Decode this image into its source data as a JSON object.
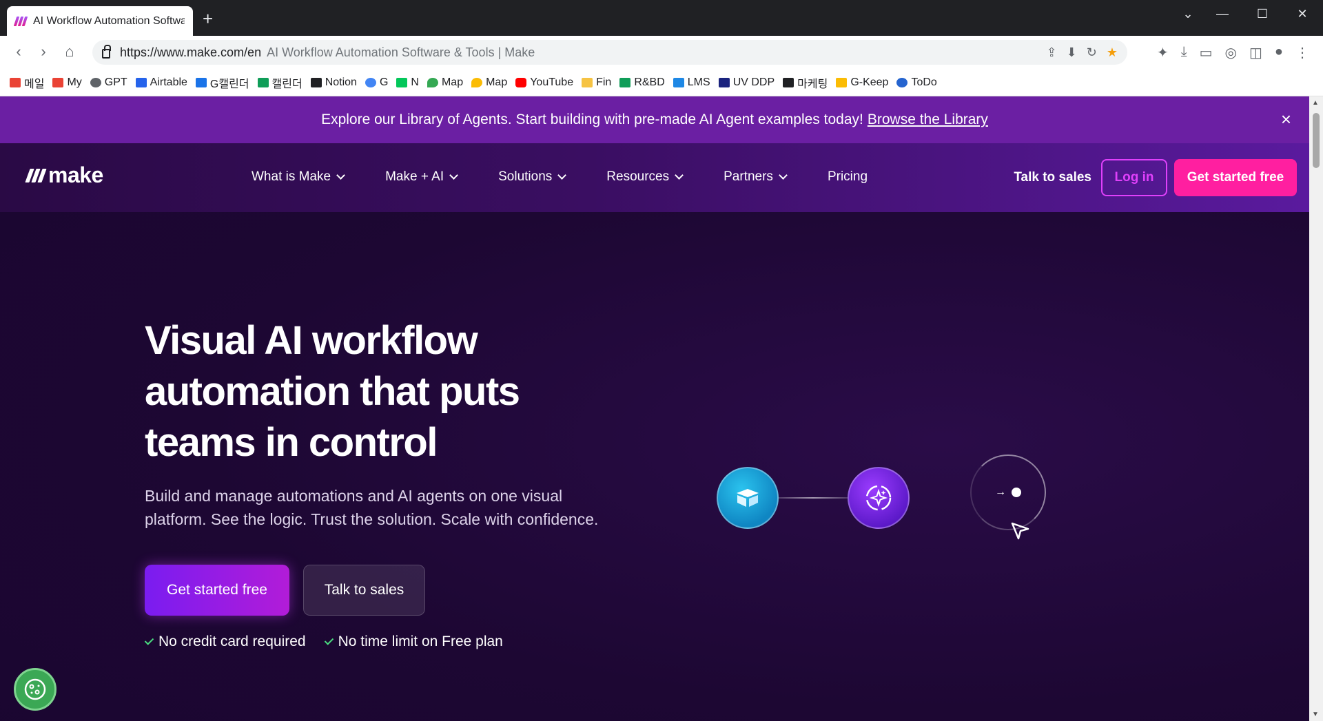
{
  "browser": {
    "tab_title": "AI Workflow Automation Softwa",
    "new_tab_symbol": "+",
    "url": "https://www.make.com/en",
    "omnibox_page_title": "AI Workflow Automation Software & Tools | Make",
    "bookmarks": [
      {
        "label": "메일",
        "color": "#ea4335"
      },
      {
        "label": "My",
        "color": "#ea4335"
      },
      {
        "label": "GPT",
        "color": "#5f6368"
      },
      {
        "label": "Airtable",
        "color": "#2563eb"
      },
      {
        "label": "G캘린더",
        "color": "#1a73e8"
      },
      {
        "label": "캘린더",
        "color": "#0f9d58"
      },
      {
        "label": "Notion",
        "color": "#202124"
      },
      {
        "label": "G",
        "color": "#4285f4"
      },
      {
        "label": "N",
        "color": "#03c75a"
      },
      {
        "label": "Map",
        "color": "#34a853"
      },
      {
        "label": "Map",
        "color": "#fbbc04"
      },
      {
        "label": "YouTube",
        "color": "#ff0000"
      },
      {
        "label": "Fin",
        "color": "#f6c343"
      },
      {
        "label": "R&BD",
        "color": "#0f9d58"
      },
      {
        "label": "LMS",
        "color": "#1e88e5"
      },
      {
        "label": "UV DDP",
        "color": "#1a237e"
      },
      {
        "label": "마케팅",
        "color": "#202124"
      },
      {
        "label": "G-Keep",
        "color": "#fbbc04"
      },
      {
        "label": "ToDo",
        "color": "#2564cf"
      }
    ]
  },
  "banner": {
    "text": "Explore our Library of Agents. Start building with pre-made AI Agent examples today!",
    "link": "Browse the Library",
    "close_symbol": "×"
  },
  "nav": {
    "logo_text": "make",
    "items": [
      {
        "label": "What is Make"
      },
      {
        "label": "Make + AI"
      },
      {
        "label": "Solutions"
      },
      {
        "label": "Resources"
      },
      {
        "label": "Partners"
      },
      {
        "label": "Pricing"
      }
    ],
    "talk_to_sales": "Talk to sales",
    "log_in": "Log in",
    "get_started": "Get started free"
  },
  "hero": {
    "title_line1": "Visual AI workflow",
    "title_line2": "automation that puts",
    "title_line3": "teams in control",
    "subtitle_line1": "Build and manage automations and AI agents on one visual",
    "subtitle_line2": "platform. See the logic. Trust the solution. Scale with confidence.",
    "cta_primary": "Get started free",
    "cta_secondary": "Talk to sales",
    "checks": [
      "No credit card required",
      "No time limit on Free plan"
    ]
  },
  "flow_diagram": {
    "arrow_symbol": "→"
  },
  "colors": {
    "accent_pink": "#ff1fa0",
    "accent_purple": "#7a1cf0",
    "banner": "#6b1fa3",
    "background": "#1d0733"
  }
}
